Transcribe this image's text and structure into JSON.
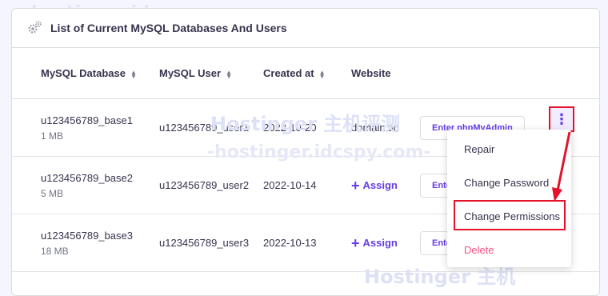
{
  "card": {
    "title": "List of Current MySQL Databases And Users",
    "gear_icon": "gears-icon"
  },
  "table": {
    "headers": [
      "MySQL Database",
      "MySQL User",
      "Created at",
      "Website"
    ],
    "sortable": [
      true,
      true,
      true,
      false
    ],
    "rows": [
      {
        "db": "u123456789_base1",
        "size": "1 MB",
        "user": "u123456789_user1",
        "created": "2022-10-20",
        "website": "domain.tld",
        "action": "Enter phpMyAdmin"
      },
      {
        "db": "u123456789_base2",
        "size": "5 MB",
        "user": "u123456789_user2",
        "created": "2022-10-14",
        "website": "Assign",
        "action": "Enter phpMyAdmin"
      },
      {
        "db": "u123456789_base3",
        "size": "18 MB",
        "user": "u123456789_user3",
        "created": "2022-10-13",
        "website": "Assign",
        "action": "Enter phpMyAdmin"
      }
    ]
  },
  "menu": {
    "items": [
      "Repair",
      "Change Password",
      "Change Permissions",
      "Delete"
    ],
    "highlighted": "Change Permissions"
  },
  "watermarks": {
    "top": "-hostinger.idcspy.com-",
    "middle_brand": "Hostinger 主机评测",
    "middle_url": "-hostinger.idcspy.com-",
    "bottom_brand": "Hostinger 主机"
  },
  "colors": {
    "accent": "#673de6",
    "highlight": "#e5122a",
    "delete": "#fc5185",
    "text": "#36344d",
    "muted": "#727586"
  }
}
